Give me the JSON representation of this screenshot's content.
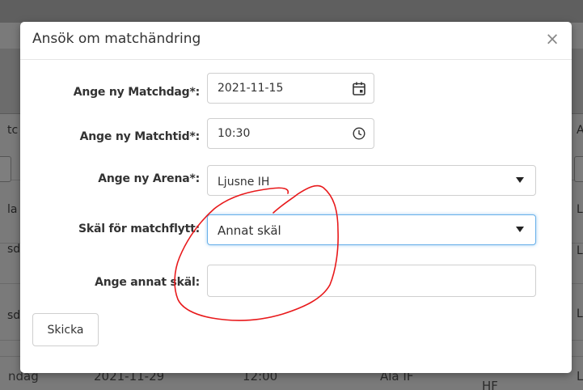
{
  "background": {
    "left_fragments": [
      "tc",
      "la",
      "sd",
      "sd"
    ],
    "right_fragments": [
      "A",
      "L",
      "L",
      "L"
    ],
    "bottom_row": [
      "ndag",
      "2021-11-29",
      "12:00",
      "Ala IF",
      "HF",
      "L"
    ]
  },
  "modal": {
    "title": "Ansök om matchändring",
    "close_symbol": "×",
    "fields": {
      "date": {
        "label": "Ange ny Matchdag*:",
        "value": "2021-11-15",
        "icon": "calendar-icon"
      },
      "time": {
        "label": "Ange ny Matchtid*:",
        "value": "10:30",
        "icon": "clock-icon"
      },
      "arena": {
        "label": "Ange ny Arena*:",
        "value": "Ljusne IH"
      },
      "reason": {
        "label": "Skäl för matchflytt:",
        "value": "Annat skäl"
      },
      "other_reason": {
        "label": "Ange annat skäl:",
        "value": ""
      }
    },
    "submit_label": "Skicka"
  },
  "colors": {
    "annotation": "#e8191b",
    "focus_border": "#66afe9"
  }
}
